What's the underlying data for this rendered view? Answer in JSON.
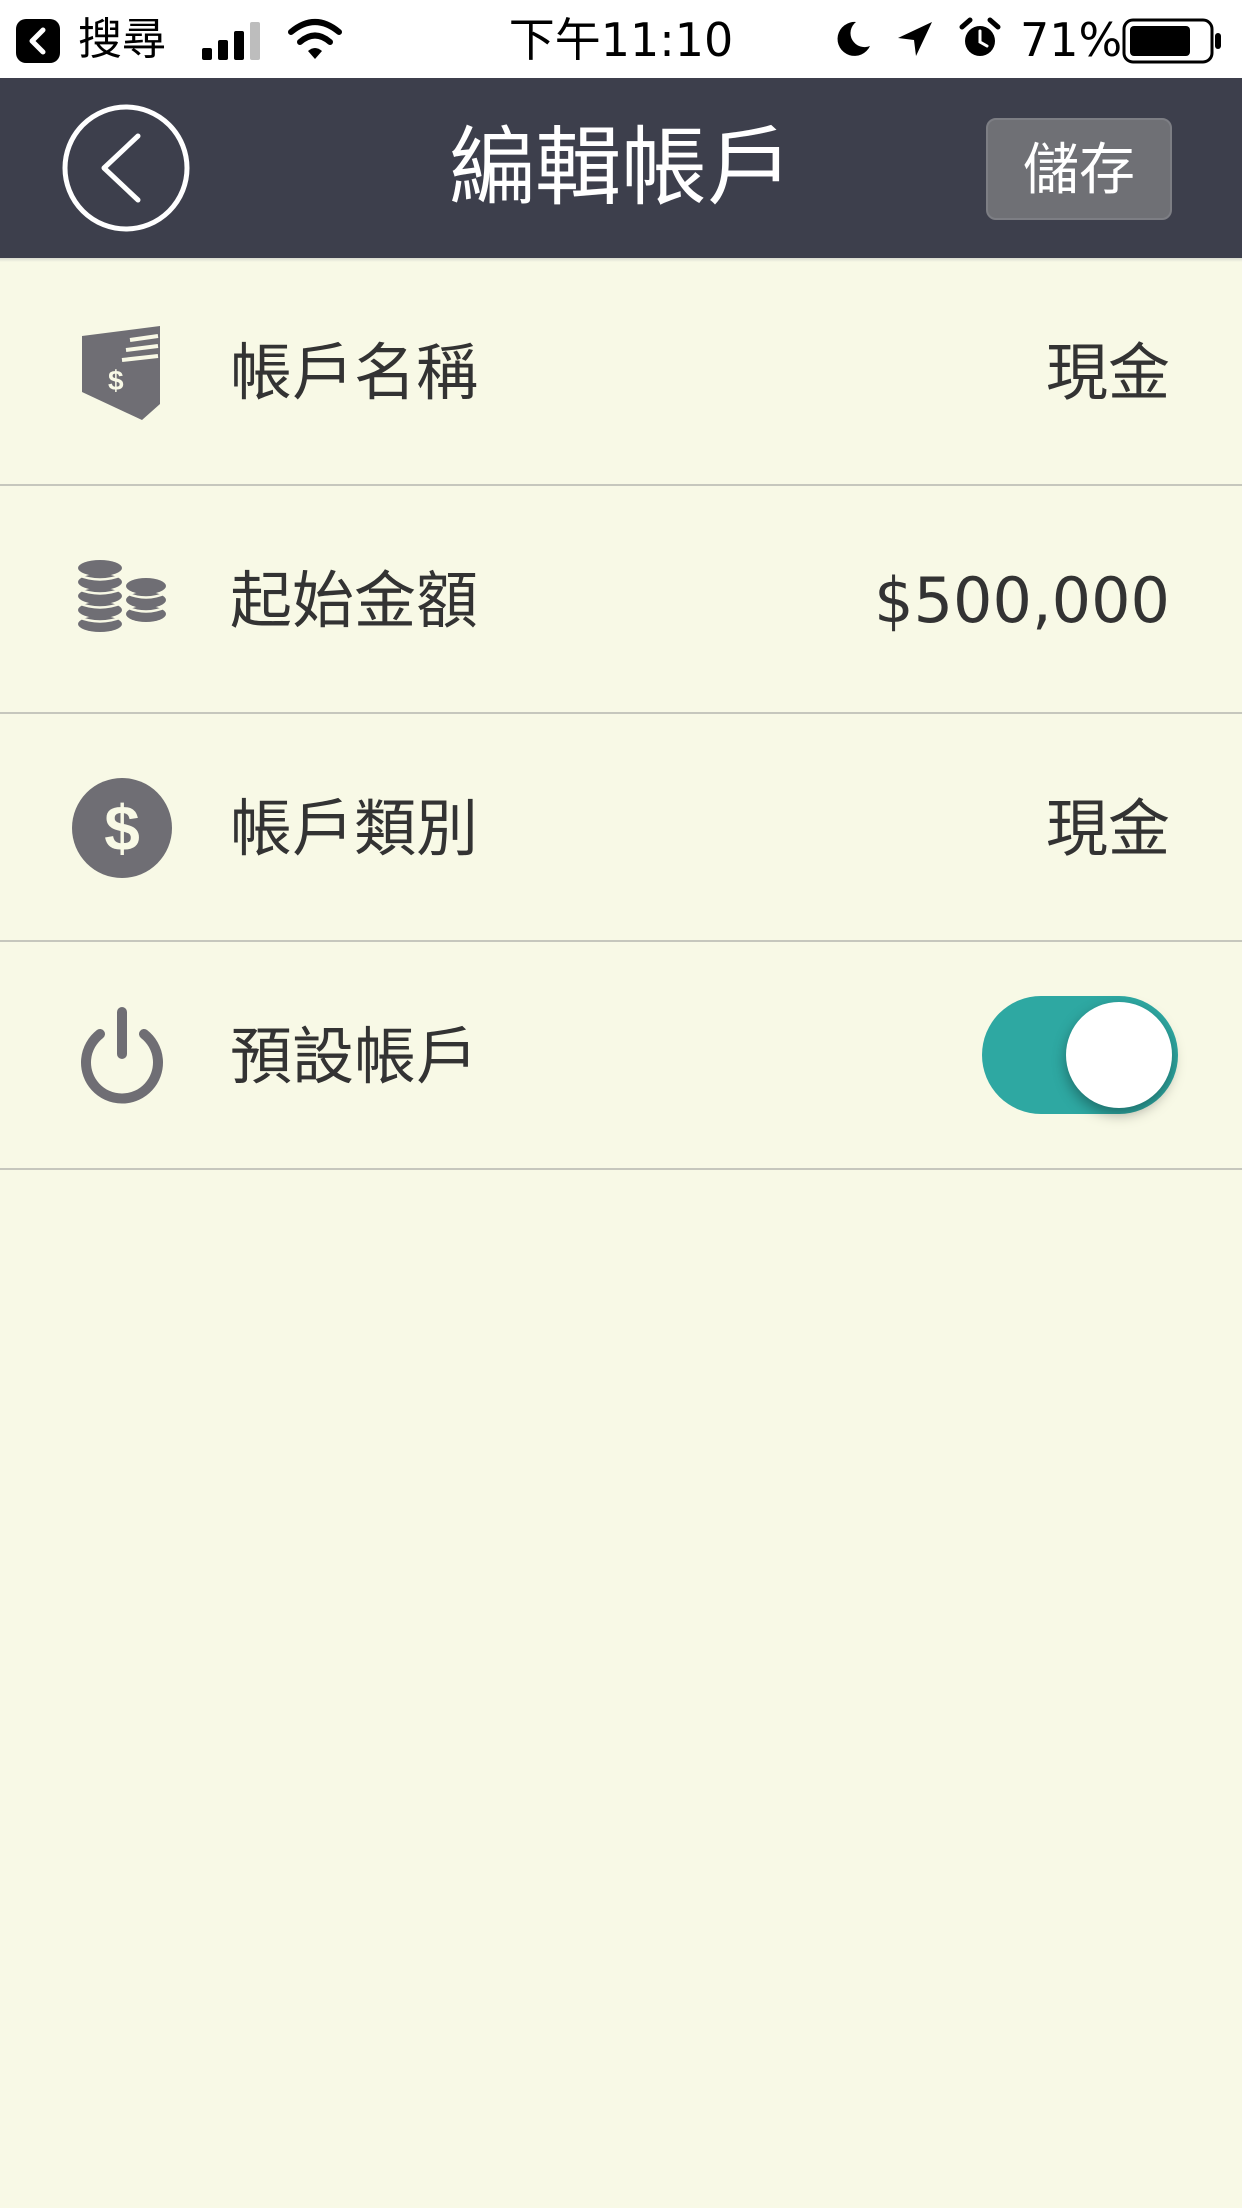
{
  "status_bar": {
    "back_app": "搜尋",
    "time": "下午11:10",
    "battery": "71%",
    "icons": [
      "back-arrow-icon",
      "signal-icon",
      "wifi-icon",
      "moon-icon",
      "location-icon",
      "alarm-icon",
      "battery-icon"
    ]
  },
  "nav": {
    "title": "編輯帳戶",
    "save_label": "儲存",
    "back_icon": "circle-chevron-left-icon"
  },
  "rows": [
    {
      "icon": "account-card-icon",
      "label": "帳戶名稱",
      "value": "現金"
    },
    {
      "icon": "coins-stack-icon",
      "label": "起始金額",
      "value": "$500,000"
    },
    {
      "icon": "dollar-circle-icon",
      "label": "帳戶類別",
      "value": "現金"
    },
    {
      "icon": "power-icon",
      "label": "預設帳戶",
      "toggle_on": true
    }
  ],
  "colors": {
    "navbar": "#3d3f4c",
    "background": "#f8f9e6",
    "toggle_on": "#2ea8a2",
    "icon_gray": "#6f6e74",
    "text": "#333333"
  }
}
